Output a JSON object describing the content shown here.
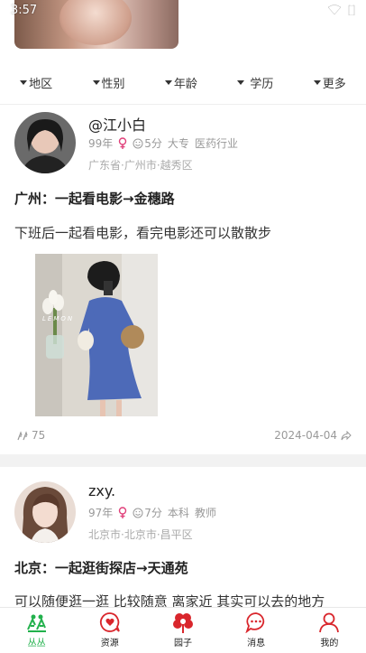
{
  "status": {
    "time": "3:57"
  },
  "filters": [
    {
      "label": "地区"
    },
    {
      "label": "性别"
    },
    {
      "label": "年龄"
    },
    {
      "label": " 学历"
    },
    {
      "label": "更多"
    }
  ],
  "posts": [
    {
      "username": "@江小白",
      "birth": "99年",
      "score": "5分",
      "education": "大专",
      "job": "医药行业",
      "location": "广东省·广州市·越秀区",
      "title": "广州：一起看电影→金穗路",
      "body": "下班后一起看电影，看完电影还可以散散步",
      "likes": "75",
      "date": "2024-04-04"
    },
    {
      "username": "zxy.",
      "birth": "97年",
      "score": "7分",
      "education": "本科",
      "job": "教师",
      "location": "北京市·北京市·昌平区",
      "title": "北京：一起逛街探店→天通苑",
      "body": "可以随便逛一逛 比较随意 离家近 其实可以去的地方"
    }
  ],
  "photo_text": "LEMON",
  "tabs": [
    {
      "label": "丛丛",
      "icon": "people-icon"
    },
    {
      "label": "资源",
      "icon": "heart-chat-icon"
    },
    {
      "label": "园子",
      "icon": "flower-icon"
    },
    {
      "label": "消息",
      "icon": "message-icon"
    },
    {
      "label": "我的",
      "icon": "user-icon"
    }
  ],
  "colors": {
    "accent": "#22b14c",
    "female": "#e0407a",
    "tab_red": "#d9262c"
  }
}
